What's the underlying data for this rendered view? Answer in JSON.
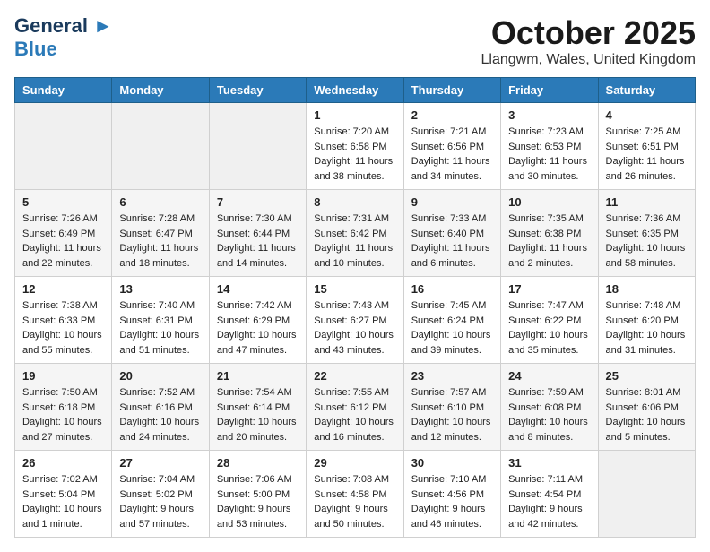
{
  "header": {
    "logo_line1": "General",
    "logo_line2": "Blue",
    "month": "October 2025",
    "location": "Llangwm, Wales, United Kingdom"
  },
  "weekdays": [
    "Sunday",
    "Monday",
    "Tuesday",
    "Wednesday",
    "Thursday",
    "Friday",
    "Saturday"
  ],
  "weeks": [
    [
      {
        "day": "",
        "info": ""
      },
      {
        "day": "",
        "info": ""
      },
      {
        "day": "",
        "info": ""
      },
      {
        "day": "1",
        "info": "Sunrise: 7:20 AM\nSunset: 6:58 PM\nDaylight: 11 hours\nand 38 minutes."
      },
      {
        "day": "2",
        "info": "Sunrise: 7:21 AM\nSunset: 6:56 PM\nDaylight: 11 hours\nand 34 minutes."
      },
      {
        "day": "3",
        "info": "Sunrise: 7:23 AM\nSunset: 6:53 PM\nDaylight: 11 hours\nand 30 minutes."
      },
      {
        "day": "4",
        "info": "Sunrise: 7:25 AM\nSunset: 6:51 PM\nDaylight: 11 hours\nand 26 minutes."
      }
    ],
    [
      {
        "day": "5",
        "info": "Sunrise: 7:26 AM\nSunset: 6:49 PM\nDaylight: 11 hours\nand 22 minutes."
      },
      {
        "day": "6",
        "info": "Sunrise: 7:28 AM\nSunset: 6:47 PM\nDaylight: 11 hours\nand 18 minutes."
      },
      {
        "day": "7",
        "info": "Sunrise: 7:30 AM\nSunset: 6:44 PM\nDaylight: 11 hours\nand 14 minutes."
      },
      {
        "day": "8",
        "info": "Sunrise: 7:31 AM\nSunset: 6:42 PM\nDaylight: 11 hours\nand 10 minutes."
      },
      {
        "day": "9",
        "info": "Sunrise: 7:33 AM\nSunset: 6:40 PM\nDaylight: 11 hours\nand 6 minutes."
      },
      {
        "day": "10",
        "info": "Sunrise: 7:35 AM\nSunset: 6:38 PM\nDaylight: 11 hours\nand 2 minutes."
      },
      {
        "day": "11",
        "info": "Sunrise: 7:36 AM\nSunset: 6:35 PM\nDaylight: 10 hours\nand 58 minutes."
      }
    ],
    [
      {
        "day": "12",
        "info": "Sunrise: 7:38 AM\nSunset: 6:33 PM\nDaylight: 10 hours\nand 55 minutes."
      },
      {
        "day": "13",
        "info": "Sunrise: 7:40 AM\nSunset: 6:31 PM\nDaylight: 10 hours\nand 51 minutes."
      },
      {
        "day": "14",
        "info": "Sunrise: 7:42 AM\nSunset: 6:29 PM\nDaylight: 10 hours\nand 47 minutes."
      },
      {
        "day": "15",
        "info": "Sunrise: 7:43 AM\nSunset: 6:27 PM\nDaylight: 10 hours\nand 43 minutes."
      },
      {
        "day": "16",
        "info": "Sunrise: 7:45 AM\nSunset: 6:24 PM\nDaylight: 10 hours\nand 39 minutes."
      },
      {
        "day": "17",
        "info": "Sunrise: 7:47 AM\nSunset: 6:22 PM\nDaylight: 10 hours\nand 35 minutes."
      },
      {
        "day": "18",
        "info": "Sunrise: 7:48 AM\nSunset: 6:20 PM\nDaylight: 10 hours\nand 31 minutes."
      }
    ],
    [
      {
        "day": "19",
        "info": "Sunrise: 7:50 AM\nSunset: 6:18 PM\nDaylight: 10 hours\nand 27 minutes."
      },
      {
        "day": "20",
        "info": "Sunrise: 7:52 AM\nSunset: 6:16 PM\nDaylight: 10 hours\nand 24 minutes."
      },
      {
        "day": "21",
        "info": "Sunrise: 7:54 AM\nSunset: 6:14 PM\nDaylight: 10 hours\nand 20 minutes."
      },
      {
        "day": "22",
        "info": "Sunrise: 7:55 AM\nSunset: 6:12 PM\nDaylight: 10 hours\nand 16 minutes."
      },
      {
        "day": "23",
        "info": "Sunrise: 7:57 AM\nSunset: 6:10 PM\nDaylight: 10 hours\nand 12 minutes."
      },
      {
        "day": "24",
        "info": "Sunrise: 7:59 AM\nSunset: 6:08 PM\nDaylight: 10 hours\nand 8 minutes."
      },
      {
        "day": "25",
        "info": "Sunrise: 8:01 AM\nSunset: 6:06 PM\nDaylight: 10 hours\nand 5 minutes."
      }
    ],
    [
      {
        "day": "26",
        "info": "Sunrise: 7:02 AM\nSunset: 5:04 PM\nDaylight: 10 hours\nand 1 minute."
      },
      {
        "day": "27",
        "info": "Sunrise: 7:04 AM\nSunset: 5:02 PM\nDaylight: 9 hours\nand 57 minutes."
      },
      {
        "day": "28",
        "info": "Sunrise: 7:06 AM\nSunset: 5:00 PM\nDaylight: 9 hours\nand 53 minutes."
      },
      {
        "day": "29",
        "info": "Sunrise: 7:08 AM\nSunset: 4:58 PM\nDaylight: 9 hours\nand 50 minutes."
      },
      {
        "day": "30",
        "info": "Sunrise: 7:10 AM\nSunset: 4:56 PM\nDaylight: 9 hours\nand 46 minutes."
      },
      {
        "day": "31",
        "info": "Sunrise: 7:11 AM\nSunset: 4:54 PM\nDaylight: 9 hours\nand 42 minutes."
      },
      {
        "day": "",
        "info": ""
      }
    ]
  ]
}
